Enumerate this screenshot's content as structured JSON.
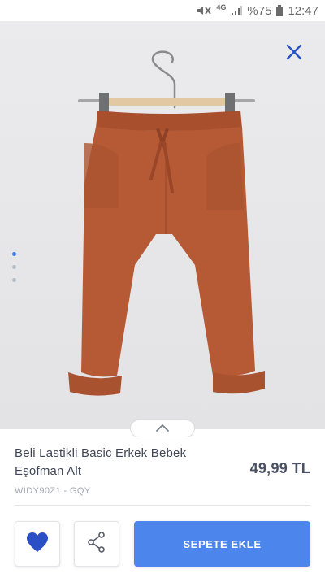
{
  "status_bar": {
    "network": "4G",
    "battery": "%75",
    "time": "12:47"
  },
  "product": {
    "title": "Beli Lastikli Basic Erkek Bebek Eşofman Alt",
    "price": "49,99 TL",
    "sku": "WIDY90Z1 - GQY",
    "image_pager": {
      "count": 3,
      "active_index": 0
    }
  },
  "actions": {
    "add_to_cart_label": "SEPETE EKLE"
  },
  "colors": {
    "accent": "#4c86ec",
    "heart": "#2b4fc4",
    "product": "#b65a35"
  },
  "icons": [
    "mute-icon",
    "signal-icon",
    "battery-icon",
    "close-icon",
    "chevron-up-icon",
    "heart-icon",
    "share-icon"
  ]
}
